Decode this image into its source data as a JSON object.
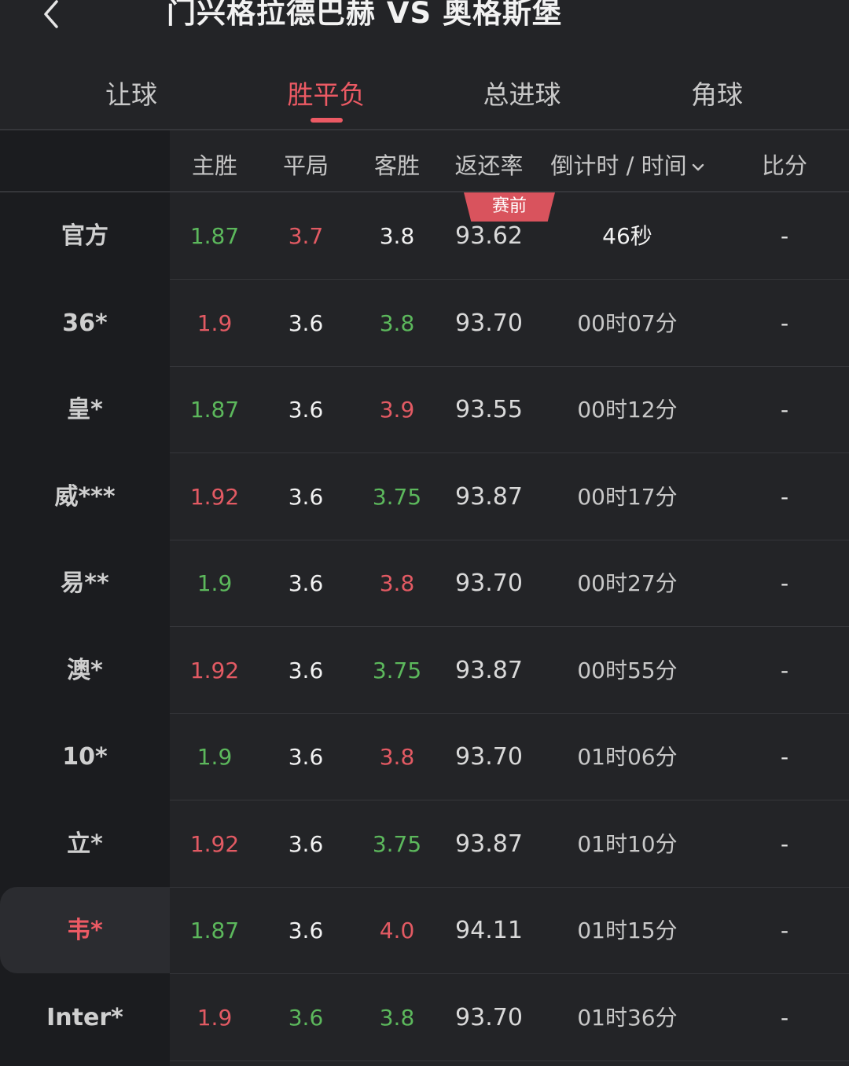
{
  "header": {
    "back_icon": "chevron-left-icon",
    "title": "门兴格拉德巴赫 VS 奥格斯堡"
  },
  "tabs": [
    {
      "label": "让球",
      "active": false
    },
    {
      "label": "胜平负",
      "active": true
    },
    {
      "label": "总进球",
      "active": false
    },
    {
      "label": "角球",
      "active": false
    }
  ],
  "columns": {
    "home": "主胜",
    "draw": "平局",
    "away": "客胜",
    "rate": "返还率",
    "time": "倒计时 / 时间",
    "score": "比分"
  },
  "badge": "赛前",
  "rows": [
    {
      "bookmaker": "官方",
      "home": "1.87",
      "draw": "3.7",
      "away": "3.8",
      "rate": "93.62",
      "time": "46秒",
      "score": "-",
      "home_color": "green",
      "draw_color": "red",
      "away_color": "white"
    },
    {
      "bookmaker": "36*",
      "home": "1.9",
      "draw": "3.6",
      "away": "3.8",
      "rate": "93.70",
      "time": "00时07分",
      "score": "-",
      "home_color": "red",
      "draw_color": "white",
      "away_color": "green"
    },
    {
      "bookmaker": "皇*",
      "home": "1.87",
      "draw": "3.6",
      "away": "3.9",
      "rate": "93.55",
      "time": "00时12分",
      "score": "-",
      "home_color": "green",
      "draw_color": "white",
      "away_color": "red"
    },
    {
      "bookmaker": "威***",
      "home": "1.92",
      "draw": "3.6",
      "away": "3.75",
      "rate": "93.87",
      "time": "00时17分",
      "score": "-",
      "home_color": "red",
      "draw_color": "white",
      "away_color": "green"
    },
    {
      "bookmaker": "易**",
      "home": "1.9",
      "draw": "3.6",
      "away": "3.8",
      "rate": "93.70",
      "time": "00时27分",
      "score": "-",
      "home_color": "green",
      "draw_color": "white",
      "away_color": "red"
    },
    {
      "bookmaker": "澳*",
      "home": "1.92",
      "draw": "3.6",
      "away": "3.75",
      "rate": "93.87",
      "time": "00时55分",
      "score": "-",
      "home_color": "red",
      "draw_color": "white",
      "away_color": "green"
    },
    {
      "bookmaker": "10*",
      "home": "1.9",
      "draw": "3.6",
      "away": "3.8",
      "rate": "93.70",
      "time": "01时06分",
      "score": "-",
      "home_color": "green",
      "draw_color": "white",
      "away_color": "red"
    },
    {
      "bookmaker": "立*",
      "home": "1.92",
      "draw": "3.6",
      "away": "3.75",
      "rate": "93.87",
      "time": "01时10分",
      "score": "-",
      "home_color": "red",
      "draw_color": "white",
      "away_color": "green"
    },
    {
      "bookmaker": "韦*",
      "home": "1.87",
      "draw": "3.6",
      "away": "4.0",
      "rate": "94.11",
      "time": "01时15分",
      "score": "-",
      "home_color": "green",
      "draw_color": "white",
      "away_color": "red",
      "selected": true
    },
    {
      "bookmaker": "Inter*",
      "home": "1.9",
      "draw": "3.6",
      "away": "3.8",
      "rate": "93.70",
      "time": "01时36分",
      "score": "-",
      "home_color": "red",
      "draw_color": "green",
      "away_color": "green"
    }
  ],
  "colors": {
    "accent": "#ec5a64",
    "up": "#e25a63",
    "down": "#5cb85c",
    "background": "#232427",
    "sidebar": "#1b1c1f"
  }
}
